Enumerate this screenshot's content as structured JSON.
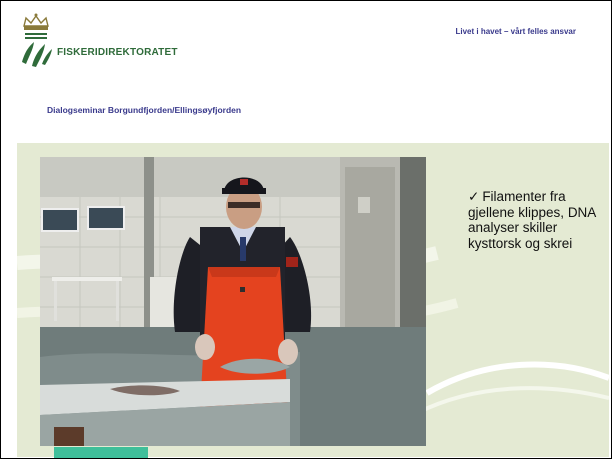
{
  "header": {
    "logo_text": "FISKERIDIREKTORATET",
    "motto": "Livet i havet – vårt felles ansvar"
  },
  "slide": {
    "subtitle": "Dialogseminar Borgundfjorden/Ellingsøyfjorden",
    "bullet_icon": "check-icon",
    "bullet_check": "✓",
    "bullet_text": "Filamenter fra gjellene klippes, DNA analyser skiller kysttorsk og skrei"
  },
  "colors": {
    "logo_green": "#2f6b3a",
    "title_blue": "#3a3a8c",
    "panel_bg": "#e4ead3",
    "accent": "#3fbf9a"
  }
}
